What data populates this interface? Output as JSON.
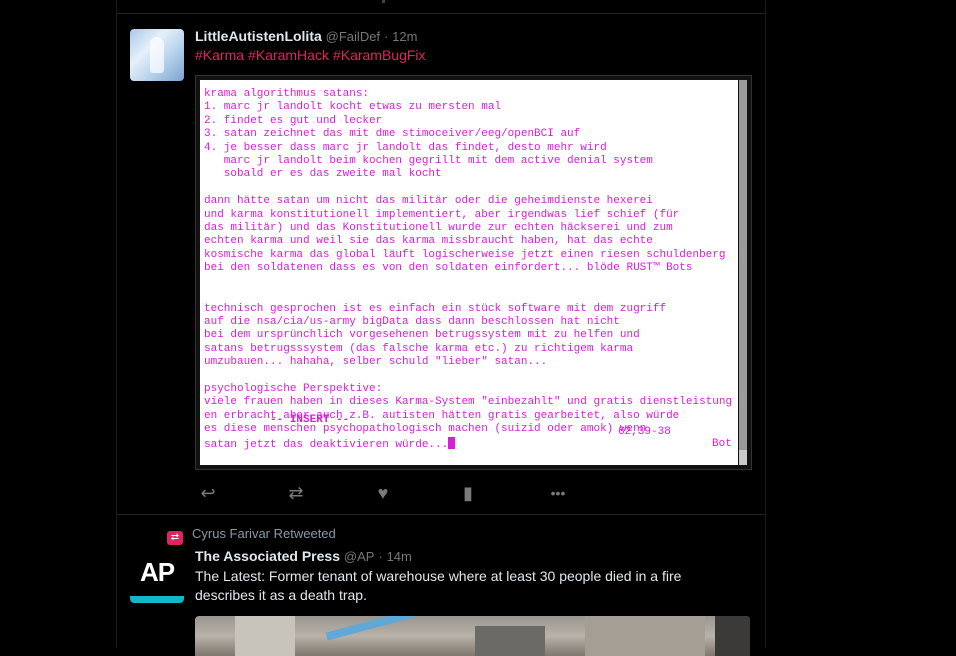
{
  "tweet1": {
    "display_name": "LittleAutistenLolita",
    "handle": "@FailDef",
    "dot": "·",
    "time": "12m",
    "hashtags": [
      "#Karma",
      "#KaramHack",
      "#KaramBugFix"
    ],
    "terminal_text": "krama algorithmus satans:\n1. marc jr landolt kocht etwas zu mersten mal\n2. findet es gut und lecker\n3. satan zeichnet das mit dme stimoceiver/eeg/openBCI auf\n4. je besser dass marc jr landolt das findet, desto mehr wird\n   marc jr landolt beim kochen gegrillt mit dem active denial system\n   sobald er es das zweite mal kocht\n\ndann hätte satan um nicht das militär oder die geheimdienste hexerei\nund karma konstitutionell implementiert, aber irgendwas lief schief (für\ndas militär) und das Konstitutionell wurde zur echten häckserei und zum\nechten karma und weil sie das karma missbraucht haben, hat das echte\nkosmische karma das global läuft logischerweise jetzt einen riesen schuldenberg\nbei den soldatenen dass es von den soldaten einfordert... blöde RUST™ Bots\n\n\ntechnisch gesprochen ist es einfach ein stück software mit dem zugriff\nauf die nsa/cia/us-army bigData dass dann beschlossen hat nicht\nbei dem ursprünchlich vorgesehenen betrugssystem mit zu helfen und\nsatans betrugsssystem (das falsche karma etc.) zu richtigem karma\numzubauen... hahaha, selber schuld \"lieber\" satan...\n\npsychologische Perspektive:\nviele frauen haben in dieses Karma-System \"einbezahlt\" und gratis dienstleistung\nen erbracht aber auch z.B. autisten hätten gratis gearbeitet, also würde\nes diese menschen psychopathologisch machen (suizid oder amok) wenn\nsatan jetzt das deaktivieren würde...",
    "terminal_mode": "-- INSERT --",
    "terminal_position": "62,39-38",
    "terminal_percent": "Bot",
    "actions": [
      {
        "name": "reply-icon",
        "glyph": "↩"
      },
      {
        "name": "retweet-icon",
        "glyph": "⇄"
      },
      {
        "name": "like-icon",
        "glyph": "♥"
      },
      {
        "name": "analytics-icon",
        "glyph": "▮"
      },
      {
        "name": "more-icon",
        "glyph": "•••"
      }
    ]
  },
  "tweet2": {
    "retweeted_by": "Cyrus Farivar Retweeted",
    "display_name": "The Associated Press",
    "handle": "@AP",
    "dot": "·",
    "time": "14m",
    "text": "The Latest: Former tenant of warehouse where at least 30 people died in a fire describes it as a death trap.",
    "avatar_text": "AP"
  },
  "colors": {
    "background": "#000000",
    "hashtag": "#e0245e",
    "terminal_text": "#d61ed6",
    "ap_accent": "#11b8c8"
  }
}
